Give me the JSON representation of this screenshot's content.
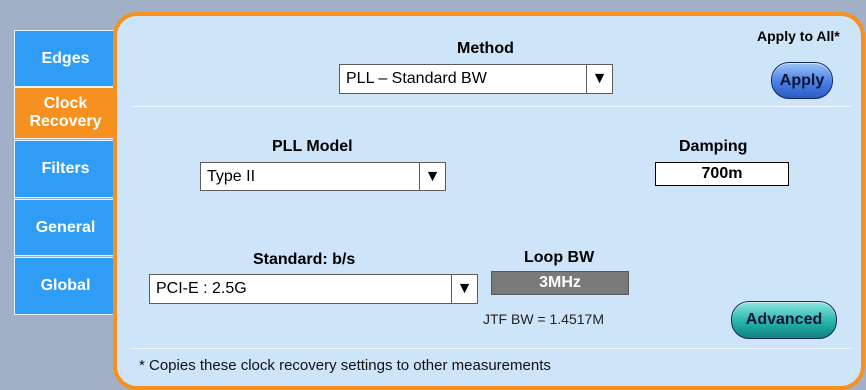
{
  "tabs": [
    {
      "label": "Edges",
      "active": false
    },
    {
      "label": "Clock\nRecovery",
      "active": true
    },
    {
      "label": "Filters",
      "active": false
    },
    {
      "label": "General",
      "active": false
    },
    {
      "label": "Global",
      "active": false
    }
  ],
  "method": {
    "label": "Method",
    "value": "PLL – Standard BW"
  },
  "apply_all": {
    "label": "Apply to All*",
    "button": "Apply"
  },
  "pll_model": {
    "label": "PLL Model",
    "value": "Type II"
  },
  "damping": {
    "label": "Damping",
    "value": "700m"
  },
  "standard": {
    "label": "Standard: b/s",
    "value": "PCI-E : 2.5G"
  },
  "loop_bw": {
    "label": "Loop BW",
    "value": "3MHz",
    "jtf": "JTF BW = 1.4517M"
  },
  "advanced_button": "Advanced",
  "footnote": "* Copies these clock recovery settings to other measurements",
  "icons": {
    "dropdown_arrow": "▼"
  },
  "colors": {
    "tab": "#2f9df6",
    "tab_active": "#f6901e",
    "panel": "#cee4f8",
    "panel_border": "#f6901e"
  }
}
